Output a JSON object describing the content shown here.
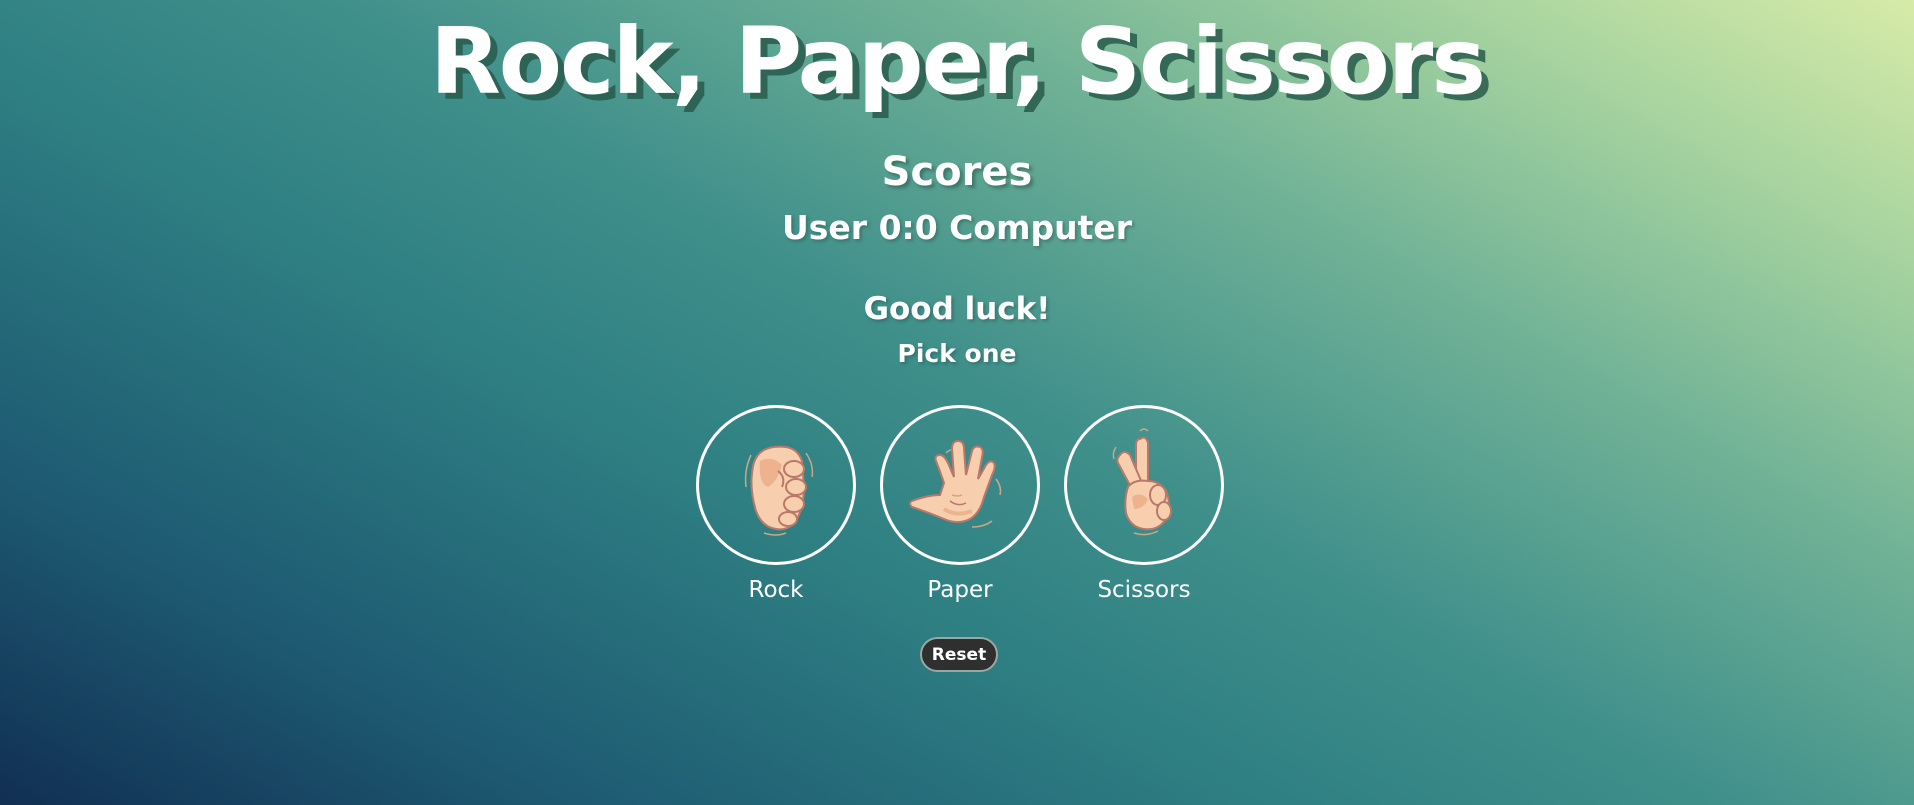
{
  "header": {
    "title": "Rock, Paper, Scissors"
  },
  "scoreboard": {
    "heading": "Scores",
    "score_text": "User 0:0 Computer"
  },
  "status": {
    "message": "Good luck!",
    "instruction": "Pick one"
  },
  "choices": [
    {
      "label": "Rock",
      "icon": "fist-hand-icon"
    },
    {
      "label": "Paper",
      "icon": "open-hand-icon"
    },
    {
      "label": "Scissors",
      "icon": "peace-hand-icon"
    }
  ],
  "controls": {
    "reset_label": "Reset"
  },
  "colors": {
    "skin": "#f7cfae",
    "skin_shadow": "#eeb28e",
    "outline": "#b9786a",
    "button_bg": "#2f2f2f"
  }
}
